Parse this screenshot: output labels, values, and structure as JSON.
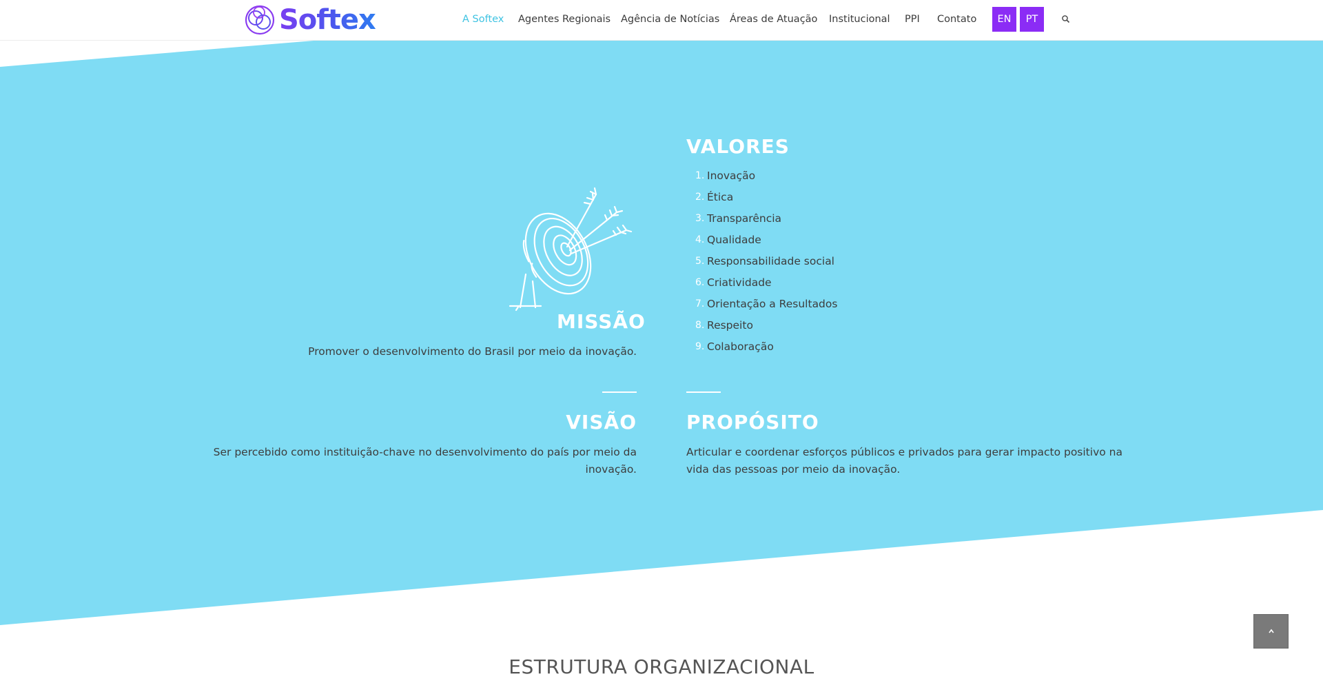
{
  "brand": {
    "name": "Softex",
    "gradient": [
      "#7a3ef0",
      "#2f7cf0"
    ]
  },
  "nav": {
    "items": [
      {
        "label": "A Softex",
        "active": true
      },
      {
        "label": "Agentes Regionais"
      },
      {
        "label": "Agência de Notícias"
      },
      {
        "label": "Áreas de Atuação"
      },
      {
        "label": "Institucional"
      },
      {
        "label": "PPI"
      },
      {
        "label": "Contato"
      }
    ],
    "languages": [
      "EN",
      "PT"
    ],
    "search_icon": "search-icon"
  },
  "colors": {
    "accent": "#3fc3e2",
    "section_bg": "#7fdcf4",
    "lang_button": "#8b2cf5",
    "heading": "#ffffff"
  },
  "mission": {
    "title": "MISSÃO",
    "text": "Promover o desenvolvimento do Brasil por meio da inovação.",
    "illustration": "target-arrows-icon"
  },
  "values": {
    "title": "VALORES",
    "items": [
      {
        "num": "1.",
        "label": "Inovação"
      },
      {
        "num": "2.",
        "label": "Ética"
      },
      {
        "num": "3.",
        "label": "Transparência"
      },
      {
        "num": "4.",
        "label": "Qualidade"
      },
      {
        "num": "5.",
        "label": "Responsabilidade social"
      },
      {
        "num": "6.",
        "label": "Criatividade"
      },
      {
        "num": "7.",
        "label": "Orientação a Resultados"
      },
      {
        "num": "8.",
        "label": "Respeito"
      },
      {
        "num": "9.",
        "label": "Colaboração"
      }
    ]
  },
  "vision": {
    "title": "VISÃO",
    "line1": "Ser percebido como instituição-chave no desenvolvimento do país por meio da",
    "line2": "inovação."
  },
  "purpose": {
    "title": "PROPÓSITO",
    "line1": "Articular e coordenar esforços públicos e privados para gerar impacto positivo na",
    "line2": "vida das pessoas por meio da inovação."
  },
  "org_structure": {
    "title": "ESTRUTURA ORGANIZACIONAL"
  },
  "scroll_top": {
    "icon": "chevron-up-icon"
  }
}
